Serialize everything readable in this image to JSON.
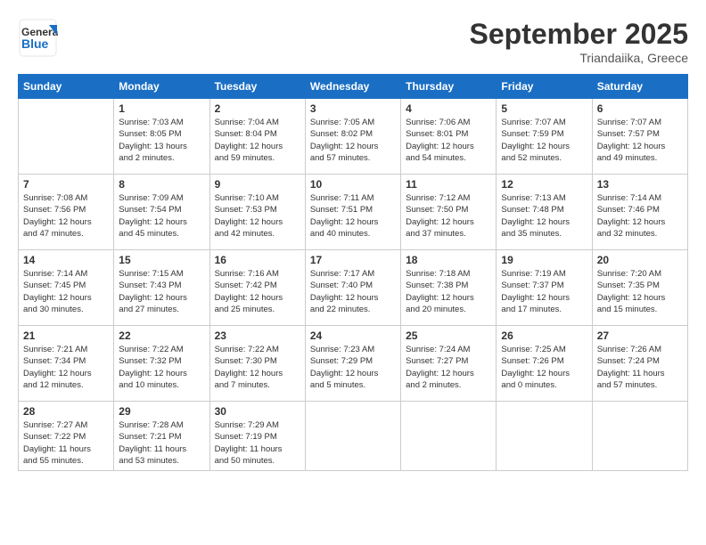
{
  "logo": {
    "general": "General",
    "blue": "Blue"
  },
  "header": {
    "month": "September 2025",
    "location": "Triandaiika, Greece"
  },
  "weekdays": [
    "Sunday",
    "Monday",
    "Tuesday",
    "Wednesday",
    "Thursday",
    "Friday",
    "Saturday"
  ],
  "weeks": [
    [
      {
        "day": "",
        "info": ""
      },
      {
        "day": "1",
        "info": "Sunrise: 7:03 AM\nSunset: 8:05 PM\nDaylight: 13 hours\nand 2 minutes."
      },
      {
        "day": "2",
        "info": "Sunrise: 7:04 AM\nSunset: 8:04 PM\nDaylight: 12 hours\nand 59 minutes."
      },
      {
        "day": "3",
        "info": "Sunrise: 7:05 AM\nSunset: 8:02 PM\nDaylight: 12 hours\nand 57 minutes."
      },
      {
        "day": "4",
        "info": "Sunrise: 7:06 AM\nSunset: 8:01 PM\nDaylight: 12 hours\nand 54 minutes."
      },
      {
        "day": "5",
        "info": "Sunrise: 7:07 AM\nSunset: 7:59 PM\nDaylight: 12 hours\nand 52 minutes."
      },
      {
        "day": "6",
        "info": "Sunrise: 7:07 AM\nSunset: 7:57 PM\nDaylight: 12 hours\nand 49 minutes."
      }
    ],
    [
      {
        "day": "7",
        "info": "Sunrise: 7:08 AM\nSunset: 7:56 PM\nDaylight: 12 hours\nand 47 minutes."
      },
      {
        "day": "8",
        "info": "Sunrise: 7:09 AM\nSunset: 7:54 PM\nDaylight: 12 hours\nand 45 minutes."
      },
      {
        "day": "9",
        "info": "Sunrise: 7:10 AM\nSunset: 7:53 PM\nDaylight: 12 hours\nand 42 minutes."
      },
      {
        "day": "10",
        "info": "Sunrise: 7:11 AM\nSunset: 7:51 PM\nDaylight: 12 hours\nand 40 minutes."
      },
      {
        "day": "11",
        "info": "Sunrise: 7:12 AM\nSunset: 7:50 PM\nDaylight: 12 hours\nand 37 minutes."
      },
      {
        "day": "12",
        "info": "Sunrise: 7:13 AM\nSunset: 7:48 PM\nDaylight: 12 hours\nand 35 minutes."
      },
      {
        "day": "13",
        "info": "Sunrise: 7:14 AM\nSunset: 7:46 PM\nDaylight: 12 hours\nand 32 minutes."
      }
    ],
    [
      {
        "day": "14",
        "info": "Sunrise: 7:14 AM\nSunset: 7:45 PM\nDaylight: 12 hours\nand 30 minutes."
      },
      {
        "day": "15",
        "info": "Sunrise: 7:15 AM\nSunset: 7:43 PM\nDaylight: 12 hours\nand 27 minutes."
      },
      {
        "day": "16",
        "info": "Sunrise: 7:16 AM\nSunset: 7:42 PM\nDaylight: 12 hours\nand 25 minutes."
      },
      {
        "day": "17",
        "info": "Sunrise: 7:17 AM\nSunset: 7:40 PM\nDaylight: 12 hours\nand 22 minutes."
      },
      {
        "day": "18",
        "info": "Sunrise: 7:18 AM\nSunset: 7:38 PM\nDaylight: 12 hours\nand 20 minutes."
      },
      {
        "day": "19",
        "info": "Sunrise: 7:19 AM\nSunset: 7:37 PM\nDaylight: 12 hours\nand 17 minutes."
      },
      {
        "day": "20",
        "info": "Sunrise: 7:20 AM\nSunset: 7:35 PM\nDaylight: 12 hours\nand 15 minutes."
      }
    ],
    [
      {
        "day": "21",
        "info": "Sunrise: 7:21 AM\nSunset: 7:34 PM\nDaylight: 12 hours\nand 12 minutes."
      },
      {
        "day": "22",
        "info": "Sunrise: 7:22 AM\nSunset: 7:32 PM\nDaylight: 12 hours\nand 10 minutes."
      },
      {
        "day": "23",
        "info": "Sunrise: 7:22 AM\nSunset: 7:30 PM\nDaylight: 12 hours\nand 7 minutes."
      },
      {
        "day": "24",
        "info": "Sunrise: 7:23 AM\nSunset: 7:29 PM\nDaylight: 12 hours\nand 5 minutes."
      },
      {
        "day": "25",
        "info": "Sunrise: 7:24 AM\nSunset: 7:27 PM\nDaylight: 12 hours\nand 2 minutes."
      },
      {
        "day": "26",
        "info": "Sunrise: 7:25 AM\nSunset: 7:26 PM\nDaylight: 12 hours\nand 0 minutes."
      },
      {
        "day": "27",
        "info": "Sunrise: 7:26 AM\nSunset: 7:24 PM\nDaylight: 11 hours\nand 57 minutes."
      }
    ],
    [
      {
        "day": "28",
        "info": "Sunrise: 7:27 AM\nSunset: 7:22 PM\nDaylight: 11 hours\nand 55 minutes."
      },
      {
        "day": "29",
        "info": "Sunrise: 7:28 AM\nSunset: 7:21 PM\nDaylight: 11 hours\nand 53 minutes."
      },
      {
        "day": "30",
        "info": "Sunrise: 7:29 AM\nSunset: 7:19 PM\nDaylight: 11 hours\nand 50 minutes."
      },
      {
        "day": "",
        "info": ""
      },
      {
        "day": "",
        "info": ""
      },
      {
        "day": "",
        "info": ""
      },
      {
        "day": "",
        "info": ""
      }
    ]
  ]
}
